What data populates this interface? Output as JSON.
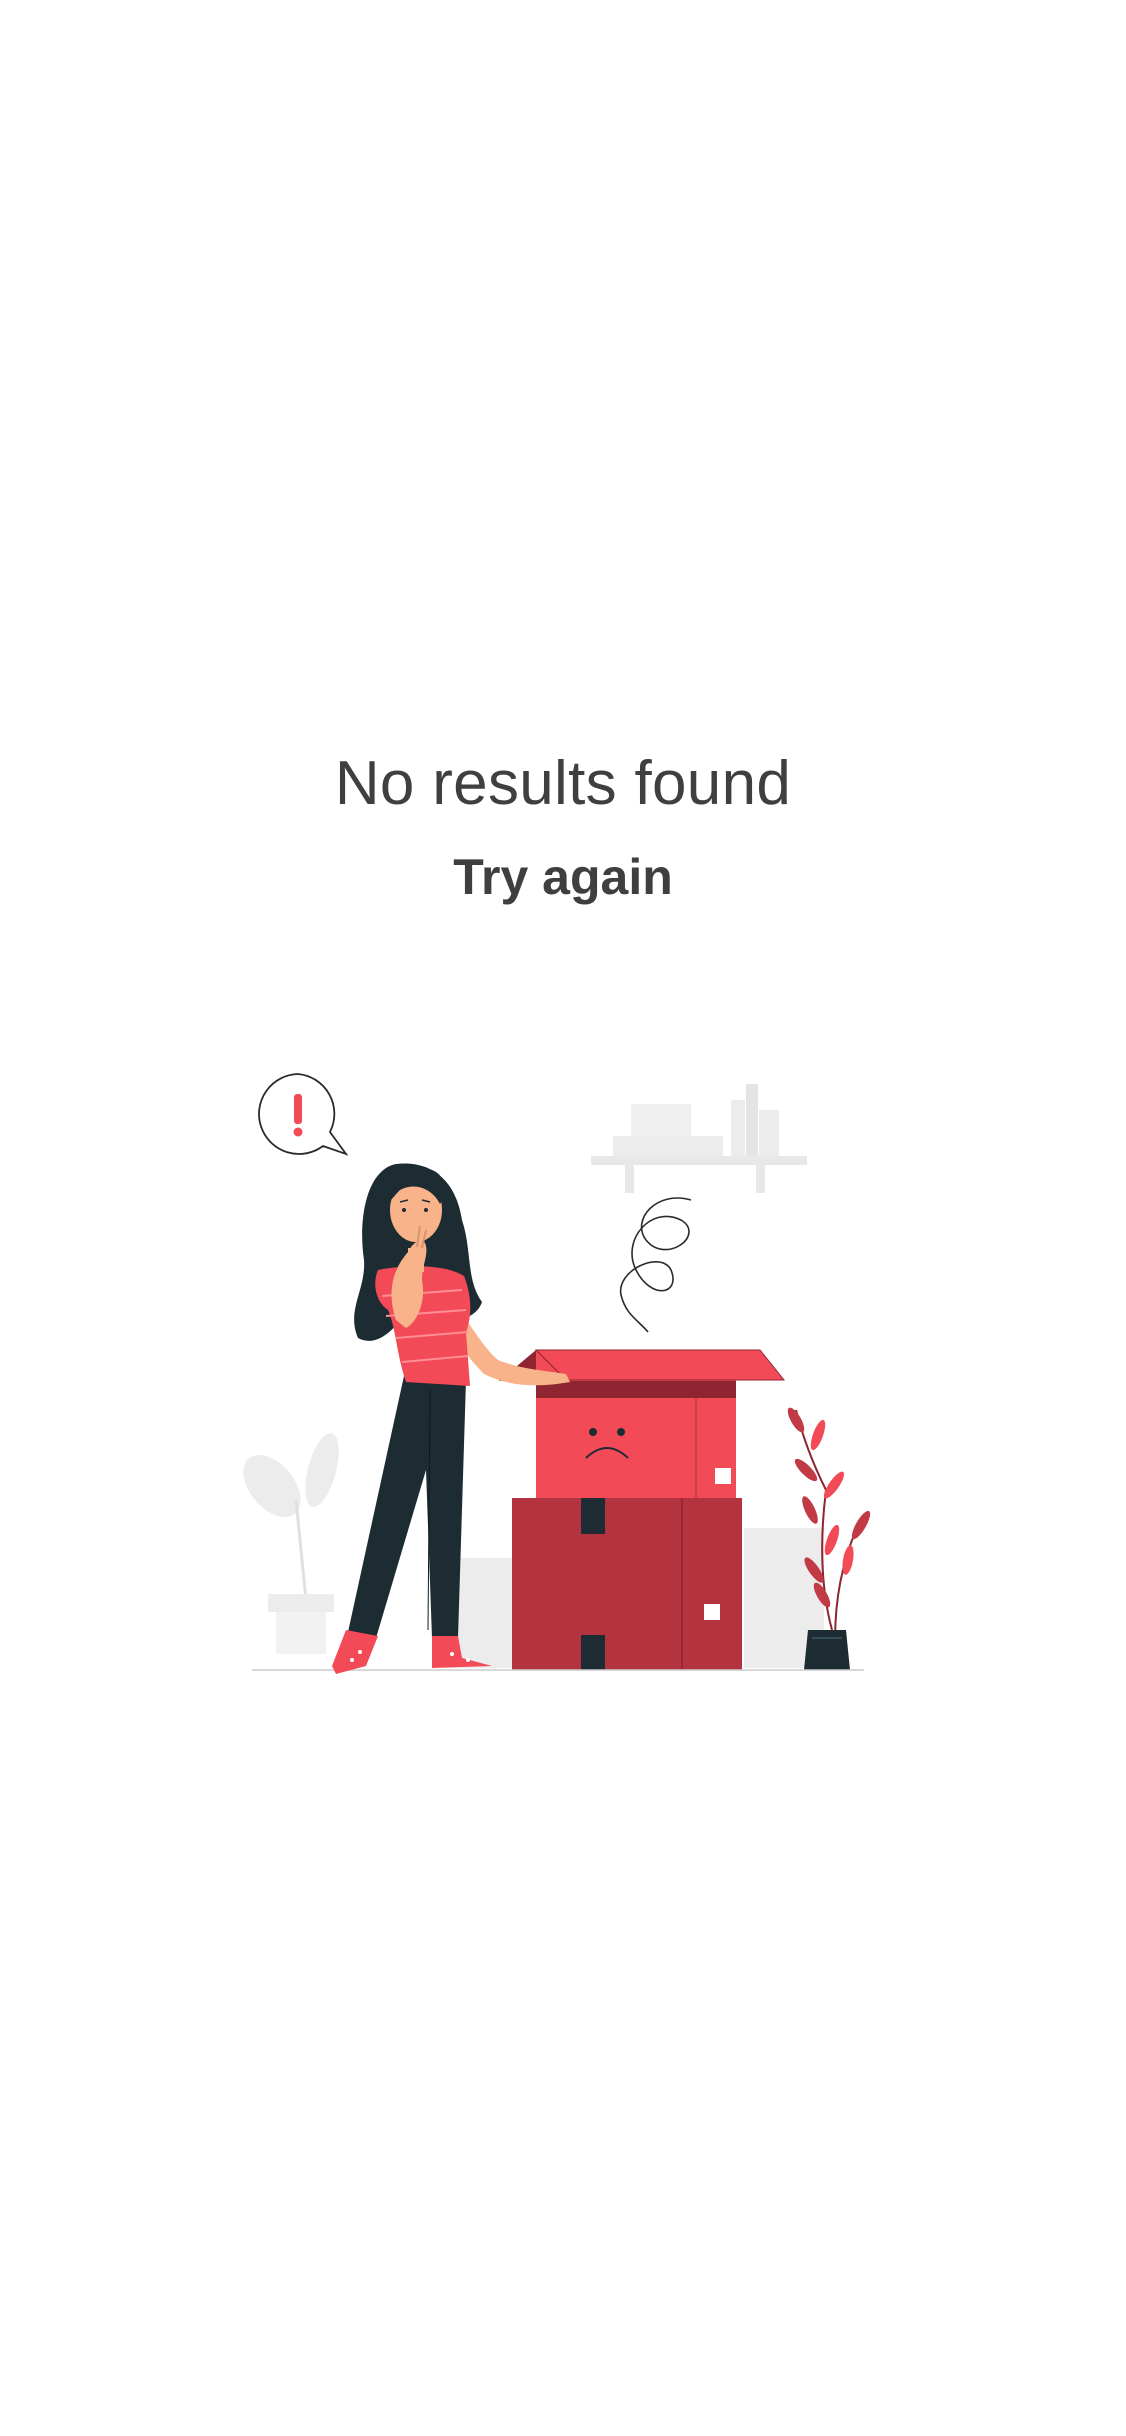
{
  "empty_state": {
    "title": "No results found",
    "subtitle": "Try again",
    "illustration": "woman-with-empty-boxes-illustration"
  },
  "colors": {
    "text": "#3f3f3f",
    "accent_red": "#f24a56",
    "dark_red": "#b3333f",
    "dark_navy": "#1d2c33",
    "skin": "#f9b38b",
    "light_gray": "#e6e6e6"
  }
}
